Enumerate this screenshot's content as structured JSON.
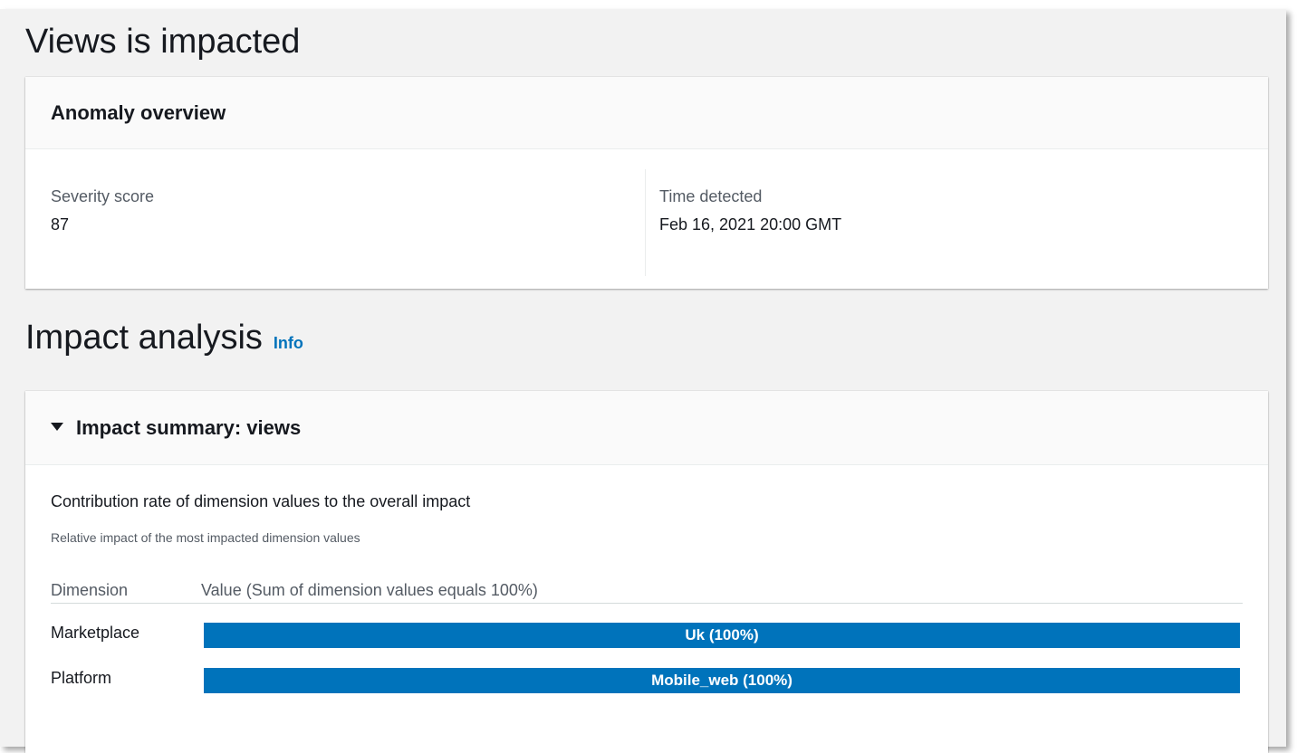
{
  "page": {
    "title": "Views is impacted"
  },
  "anomaly_overview": {
    "header": "Anomaly overview",
    "severity_label": "Severity score",
    "severity_value": "87",
    "time_label": "Time detected",
    "time_value": "Feb 16, 2021 20:00 GMT"
  },
  "impact_analysis": {
    "title": "Impact analysis",
    "info_link": "Info"
  },
  "impact_summary": {
    "header": "Impact summary: views",
    "expanded": true,
    "chart_title": "Contribution rate of dimension values to the overall impact",
    "chart_subtitle": "Relative impact of the most impacted dimension values",
    "col_dimension": "Dimension",
    "col_value": "Value (Sum of dimension values equals 100%)",
    "bar_color": "#0073bb",
    "rows": [
      {
        "dimension": "Marketplace",
        "segments": [
          {
            "label": "Uk (100%)",
            "value": 100
          }
        ]
      },
      {
        "dimension": "Platform",
        "segments": [
          {
            "label": "Mobile_web (100%)",
            "value": 100
          }
        ]
      }
    ]
  }
}
